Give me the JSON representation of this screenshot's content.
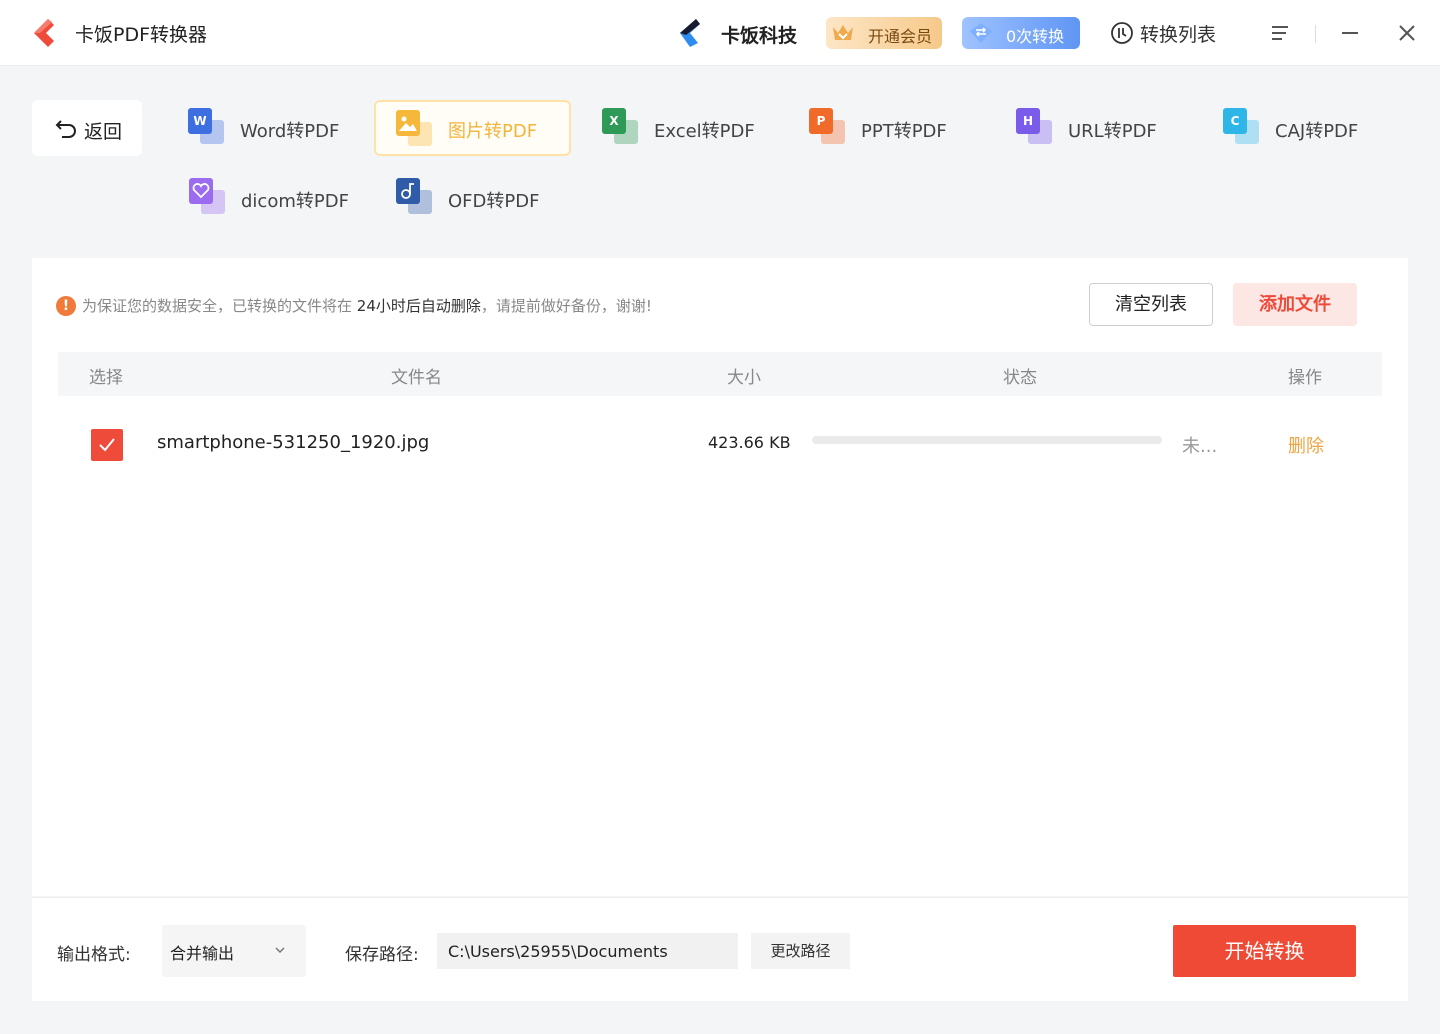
{
  "titlebar": {
    "app_title": "卡饭PDF转换器",
    "brand_name": "卡饭科技",
    "vip_label": "开通会员",
    "conversions_label": "0次转换",
    "list_label": "转换列表"
  },
  "nav": {
    "back_label": "返回",
    "tools": [
      {
        "label": "Word转PDF",
        "badge": "W",
        "color": "#3d6fe0"
      },
      {
        "label": "图片转PDF",
        "badge": "",
        "color": "#f5b83a"
      },
      {
        "label": "Excel转PDF",
        "badge": "X",
        "color": "#2f9a57"
      },
      {
        "label": "PPT转PDF",
        "badge": "P",
        "color": "#f06a2a"
      },
      {
        "label": "URL转PDF",
        "badge": "H",
        "color": "#7a5bea"
      },
      {
        "label": "CAJ转PDF",
        "badge": "C",
        "color": "#2fb6e8"
      },
      {
        "label": "dicom转PDF",
        "badge": "",
        "color": "#9b6cf0"
      },
      {
        "label": "OFD转PDF",
        "badge": "",
        "color": "#2f5ba8"
      }
    ],
    "active_index": 1
  },
  "notice": {
    "text_before": "为保证您的数据安全，已转换的文件将在 ",
    "highlight": "24小时后自动删除",
    "text_after": "，请提前做好备份，谢谢!"
  },
  "actions": {
    "clear_label": "清空列表",
    "add_label": "添加文件"
  },
  "table": {
    "headers": [
      "选择",
      "文件名",
      "大小",
      "状态",
      "操作"
    ],
    "rows": [
      {
        "checked": true,
        "filename": "smartphone-531250_1920.jpg",
        "size": "423.66 KB",
        "progress": 0,
        "status": "未...",
        "action": "删除"
      }
    ]
  },
  "bottom": {
    "output_label": "输出格式:",
    "output_value": "合并输出",
    "path_label": "保存路径:",
    "path_value": "C:\\Users\\25955\\Documents",
    "change_path_label": "更改路径",
    "start_label": "开始转换"
  },
  "colors": {
    "accent": "#ef4a35",
    "active_tool": "#f3b43a",
    "delete": "#f3a340"
  }
}
